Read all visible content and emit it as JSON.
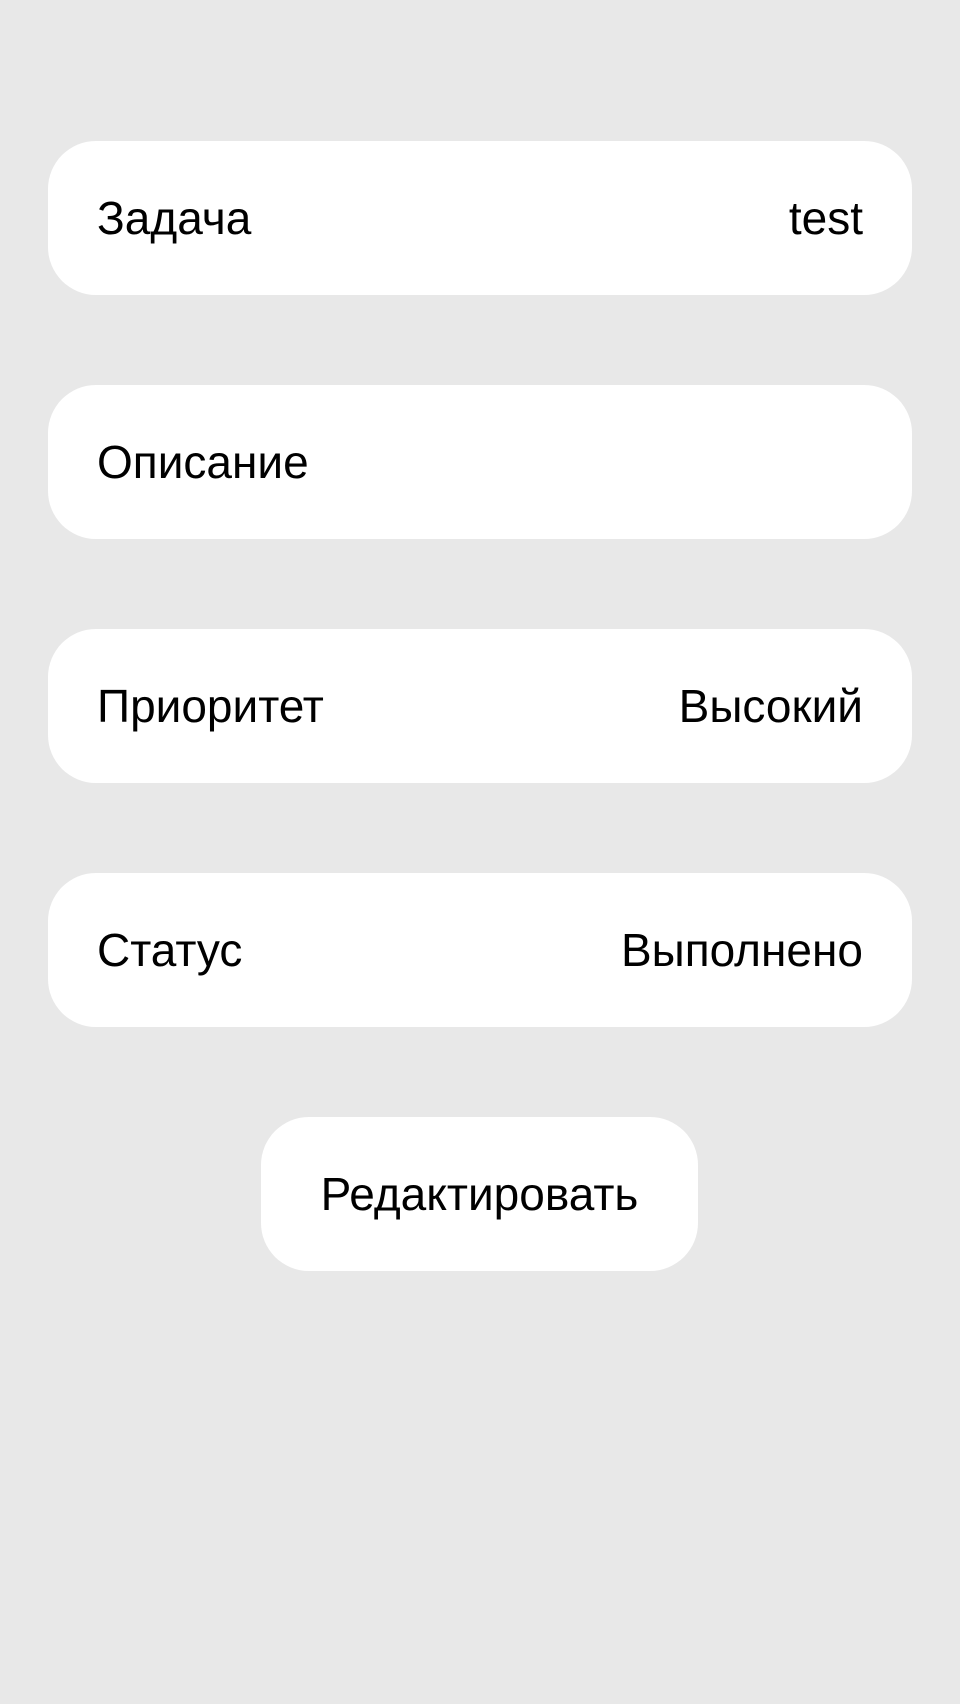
{
  "details": {
    "task": {
      "label": "Задача",
      "value": "test"
    },
    "description": {
      "label": "Описание",
      "value": ""
    },
    "priority": {
      "label": "Приоритет",
      "value": "Высокий"
    },
    "status": {
      "label": "Статус",
      "value": "Выполнено"
    }
  },
  "actions": {
    "edit_label": "Редактировать"
  },
  "colors": {
    "background": "#e8e8e8",
    "card": "#ffffff",
    "text": "#000000"
  }
}
